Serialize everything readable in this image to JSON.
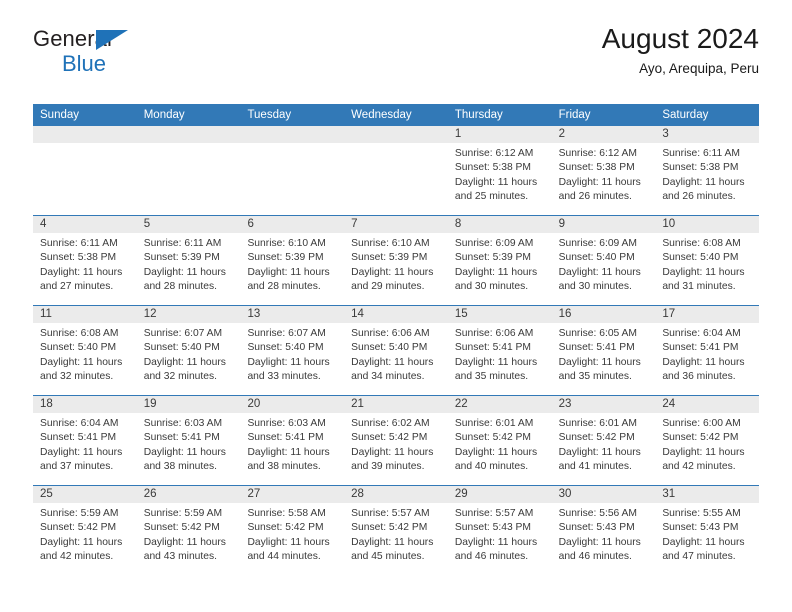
{
  "brand": {
    "line1": "General",
    "line2": "Blue",
    "flag_icon": "triangle-flag-icon",
    "accent_color": "#1f72b8"
  },
  "header": {
    "title": "August 2024",
    "location": "Ayo, Arequipa, Peru"
  },
  "calendar": {
    "header_bg": "#3279b7",
    "daynum_bg": "#ebebeb",
    "weekdays": [
      "Sunday",
      "Monday",
      "Tuesday",
      "Wednesday",
      "Thursday",
      "Friday",
      "Saturday"
    ],
    "weeks": [
      [
        {
          "day": "",
          "lines": []
        },
        {
          "day": "",
          "lines": []
        },
        {
          "day": "",
          "lines": []
        },
        {
          "day": "",
          "lines": []
        },
        {
          "day": "1",
          "lines": [
            "Sunrise: 6:12 AM",
            "Sunset: 5:38 PM",
            "Daylight: 11 hours",
            "and 25 minutes."
          ]
        },
        {
          "day": "2",
          "lines": [
            "Sunrise: 6:12 AM",
            "Sunset: 5:38 PM",
            "Daylight: 11 hours",
            "and 26 minutes."
          ]
        },
        {
          "day": "3",
          "lines": [
            "Sunrise: 6:11 AM",
            "Sunset: 5:38 PM",
            "Daylight: 11 hours",
            "and 26 minutes."
          ]
        }
      ],
      [
        {
          "day": "4",
          "lines": [
            "Sunrise: 6:11 AM",
            "Sunset: 5:38 PM",
            "Daylight: 11 hours",
            "and 27 minutes."
          ]
        },
        {
          "day": "5",
          "lines": [
            "Sunrise: 6:11 AM",
            "Sunset: 5:39 PM",
            "Daylight: 11 hours",
            "and 28 minutes."
          ]
        },
        {
          "day": "6",
          "lines": [
            "Sunrise: 6:10 AM",
            "Sunset: 5:39 PM",
            "Daylight: 11 hours",
            "and 28 minutes."
          ]
        },
        {
          "day": "7",
          "lines": [
            "Sunrise: 6:10 AM",
            "Sunset: 5:39 PM",
            "Daylight: 11 hours",
            "and 29 minutes."
          ]
        },
        {
          "day": "8",
          "lines": [
            "Sunrise: 6:09 AM",
            "Sunset: 5:39 PM",
            "Daylight: 11 hours",
            "and 30 minutes."
          ]
        },
        {
          "day": "9",
          "lines": [
            "Sunrise: 6:09 AM",
            "Sunset: 5:40 PM",
            "Daylight: 11 hours",
            "and 30 minutes."
          ]
        },
        {
          "day": "10",
          "lines": [
            "Sunrise: 6:08 AM",
            "Sunset: 5:40 PM",
            "Daylight: 11 hours",
            "and 31 minutes."
          ]
        }
      ],
      [
        {
          "day": "11",
          "lines": [
            "Sunrise: 6:08 AM",
            "Sunset: 5:40 PM",
            "Daylight: 11 hours",
            "and 32 minutes."
          ]
        },
        {
          "day": "12",
          "lines": [
            "Sunrise: 6:07 AM",
            "Sunset: 5:40 PM",
            "Daylight: 11 hours",
            "and 32 minutes."
          ]
        },
        {
          "day": "13",
          "lines": [
            "Sunrise: 6:07 AM",
            "Sunset: 5:40 PM",
            "Daylight: 11 hours",
            "and 33 minutes."
          ]
        },
        {
          "day": "14",
          "lines": [
            "Sunrise: 6:06 AM",
            "Sunset: 5:40 PM",
            "Daylight: 11 hours",
            "and 34 minutes."
          ]
        },
        {
          "day": "15",
          "lines": [
            "Sunrise: 6:06 AM",
            "Sunset: 5:41 PM",
            "Daylight: 11 hours",
            "and 35 minutes."
          ]
        },
        {
          "day": "16",
          "lines": [
            "Sunrise: 6:05 AM",
            "Sunset: 5:41 PM",
            "Daylight: 11 hours",
            "and 35 minutes."
          ]
        },
        {
          "day": "17",
          "lines": [
            "Sunrise: 6:04 AM",
            "Sunset: 5:41 PM",
            "Daylight: 11 hours",
            "and 36 minutes."
          ]
        }
      ],
      [
        {
          "day": "18",
          "lines": [
            "Sunrise: 6:04 AM",
            "Sunset: 5:41 PM",
            "Daylight: 11 hours",
            "and 37 minutes."
          ]
        },
        {
          "day": "19",
          "lines": [
            "Sunrise: 6:03 AM",
            "Sunset: 5:41 PM",
            "Daylight: 11 hours",
            "and 38 minutes."
          ]
        },
        {
          "day": "20",
          "lines": [
            "Sunrise: 6:03 AM",
            "Sunset: 5:41 PM",
            "Daylight: 11 hours",
            "and 38 minutes."
          ]
        },
        {
          "day": "21",
          "lines": [
            "Sunrise: 6:02 AM",
            "Sunset: 5:42 PM",
            "Daylight: 11 hours",
            "and 39 minutes."
          ]
        },
        {
          "day": "22",
          "lines": [
            "Sunrise: 6:01 AM",
            "Sunset: 5:42 PM",
            "Daylight: 11 hours",
            "and 40 minutes."
          ]
        },
        {
          "day": "23",
          "lines": [
            "Sunrise: 6:01 AM",
            "Sunset: 5:42 PM",
            "Daylight: 11 hours",
            "and 41 minutes."
          ]
        },
        {
          "day": "24",
          "lines": [
            "Sunrise: 6:00 AM",
            "Sunset: 5:42 PM",
            "Daylight: 11 hours",
            "and 42 minutes."
          ]
        }
      ],
      [
        {
          "day": "25",
          "lines": [
            "Sunrise: 5:59 AM",
            "Sunset: 5:42 PM",
            "Daylight: 11 hours",
            "and 42 minutes."
          ]
        },
        {
          "day": "26",
          "lines": [
            "Sunrise: 5:59 AM",
            "Sunset: 5:42 PM",
            "Daylight: 11 hours",
            "and 43 minutes."
          ]
        },
        {
          "day": "27",
          "lines": [
            "Sunrise: 5:58 AM",
            "Sunset: 5:42 PM",
            "Daylight: 11 hours",
            "and 44 minutes."
          ]
        },
        {
          "day": "28",
          "lines": [
            "Sunrise: 5:57 AM",
            "Sunset: 5:42 PM",
            "Daylight: 11 hours",
            "and 45 minutes."
          ]
        },
        {
          "day": "29",
          "lines": [
            "Sunrise: 5:57 AM",
            "Sunset: 5:43 PM",
            "Daylight: 11 hours",
            "and 46 minutes."
          ]
        },
        {
          "day": "30",
          "lines": [
            "Sunrise: 5:56 AM",
            "Sunset: 5:43 PM",
            "Daylight: 11 hours",
            "and 46 minutes."
          ]
        },
        {
          "day": "31",
          "lines": [
            "Sunrise: 5:55 AM",
            "Sunset: 5:43 PM",
            "Daylight: 11 hours",
            "and 47 minutes."
          ]
        }
      ]
    ]
  }
}
